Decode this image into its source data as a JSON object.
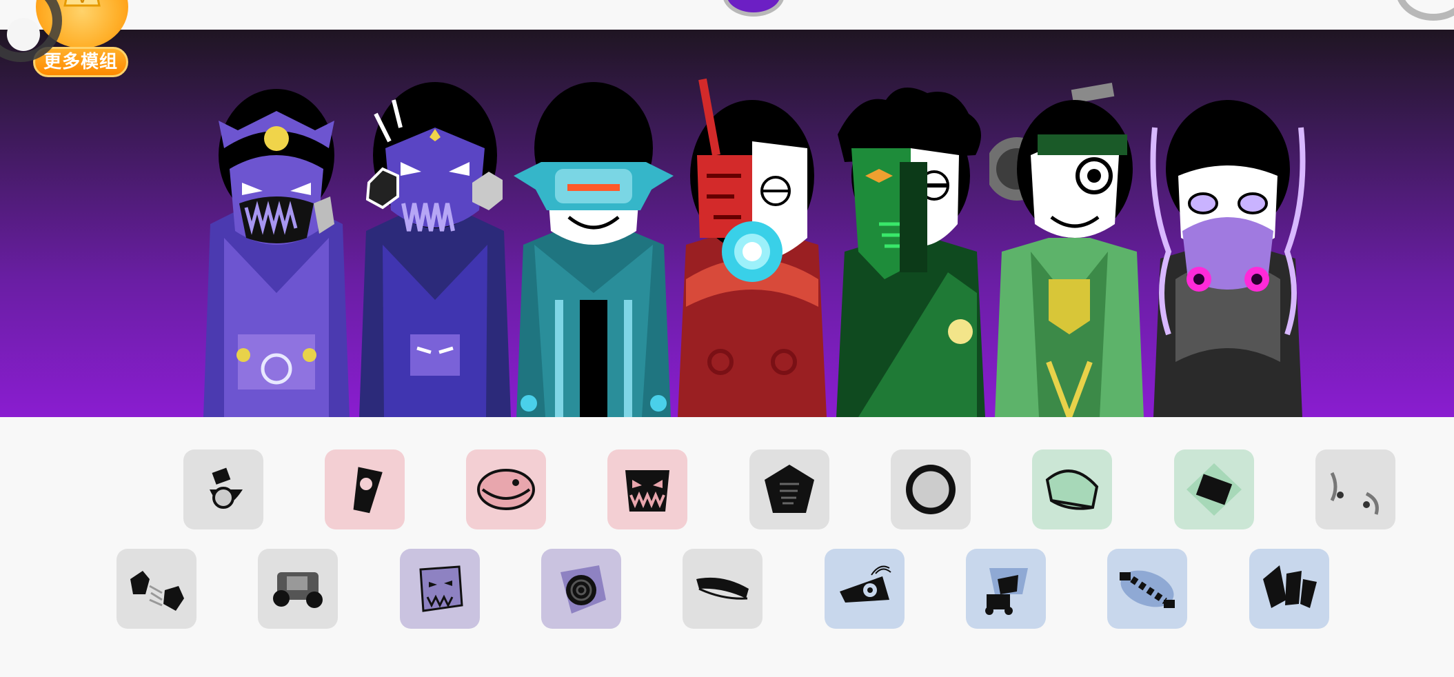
{
  "top": {
    "more_mods_label": "更多模组"
  },
  "stage": {
    "characters": [
      {
        "name": "purple-skull-cap-singer"
      },
      {
        "name": "violet-demon-mask-singer"
      },
      {
        "name": "teal-visor-singer"
      },
      {
        "name": "red-cyber-singer"
      },
      {
        "name": "green-mask-singer"
      },
      {
        "name": "green-gear-singer"
      },
      {
        "name": "gray-ghost-singer"
      }
    ]
  },
  "sounds": {
    "row1": [
      {
        "icon": "beats-ring-icon",
        "color": "gray"
      },
      {
        "icon": "beats-cup-icon",
        "color": "pink"
      },
      {
        "icon": "beats-oval-icon",
        "color": "pink"
      },
      {
        "icon": "beats-teeth-icon",
        "color": "pink"
      },
      {
        "icon": "fx-pentagon-icon",
        "color": "gray"
      },
      {
        "icon": "fx-sun-icon",
        "color": "gray"
      },
      {
        "icon": "melody-leaf-icon",
        "color": "green"
      },
      {
        "icon": "melody-diamond-icon",
        "color": "green"
      },
      {
        "icon": "melody-swirl-icon",
        "color": "gray"
      }
    ],
    "row2": [
      {
        "icon": "effects-hexes-icon",
        "color": "gray"
      },
      {
        "icon": "effects-machine-icon",
        "color": "gray"
      },
      {
        "icon": "voice-skull-icon",
        "color": "purple"
      },
      {
        "icon": "voice-spiral-icon",
        "color": "purple"
      },
      {
        "icon": "voice-mustache-icon",
        "color": "gray"
      },
      {
        "icon": "voice-eye-icon",
        "color": "blue"
      },
      {
        "icon": "voice-periscope-icon",
        "color": "blue"
      },
      {
        "icon": "voice-chain-icon",
        "color": "blue"
      },
      {
        "icon": "voice-shards-icon",
        "color": "blue"
      }
    ]
  },
  "colors": {
    "gray": "#e0e0e0",
    "pink": "#f3cfd3",
    "green": "#cbe6d5",
    "purple": "#cac3e0",
    "blue": "#c8d7ec"
  }
}
